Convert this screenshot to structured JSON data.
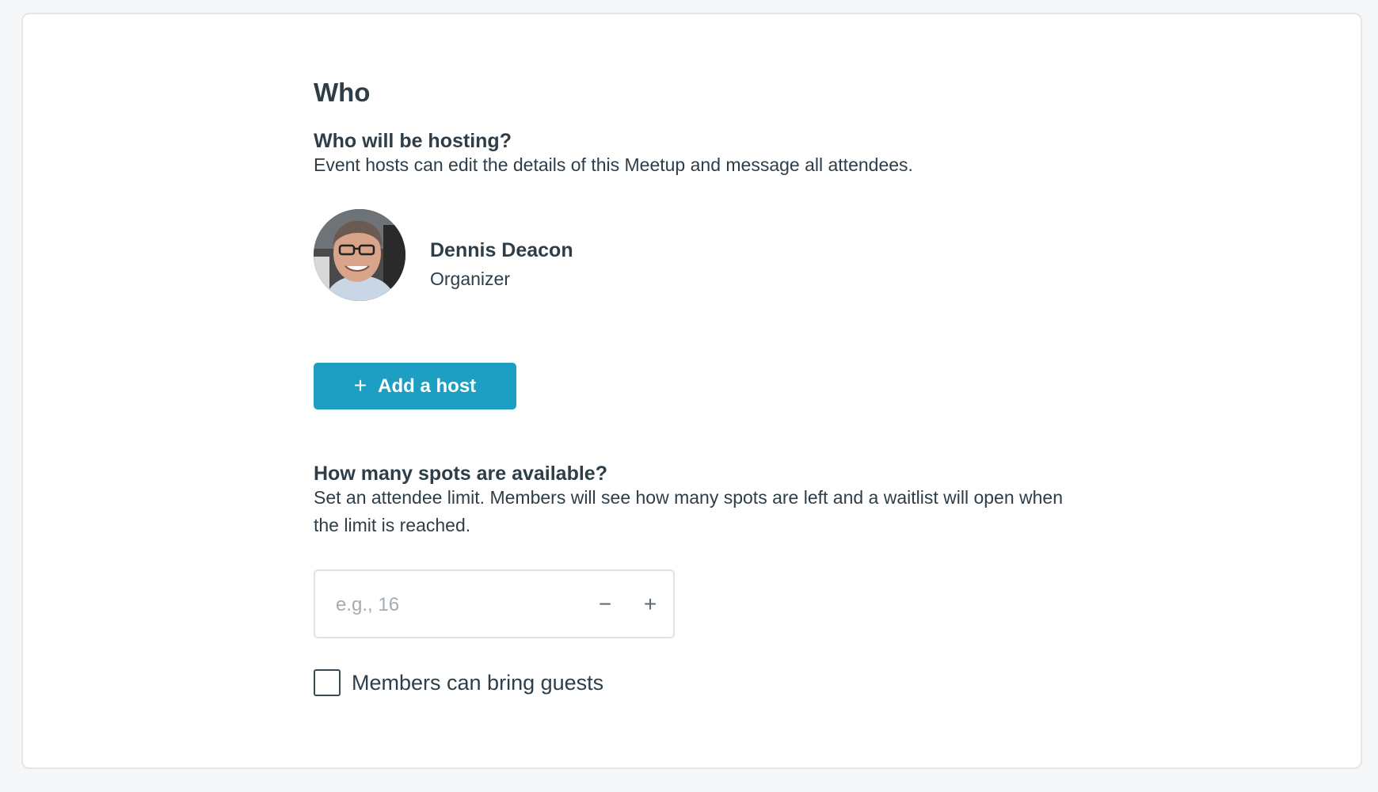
{
  "section": {
    "title": "Who"
  },
  "hosting": {
    "title": "Who will be hosting?",
    "description": "Event hosts can edit the details of this Meetup and message all attendees.",
    "host": {
      "name": "Dennis Deacon",
      "role": "Organizer"
    },
    "add_host_icon": "plus-icon",
    "add_host_label": "Add a host"
  },
  "spots": {
    "title": "How many spots are available?",
    "description": "Set an attendee limit. Members will see how many spots are left and a waitlist will open when the limit is reached.",
    "input": {
      "value": "",
      "placeholder": "e.g., 16"
    },
    "decrement_icon": "minus-icon",
    "increment_icon": "plus-icon"
  },
  "guests": {
    "checked": false,
    "label": "Members can bring guests"
  },
  "colors": {
    "accent": "#1d9fc4",
    "text": "#2e3e48",
    "background": "#f6f7f8",
    "card": "#ffffff"
  }
}
